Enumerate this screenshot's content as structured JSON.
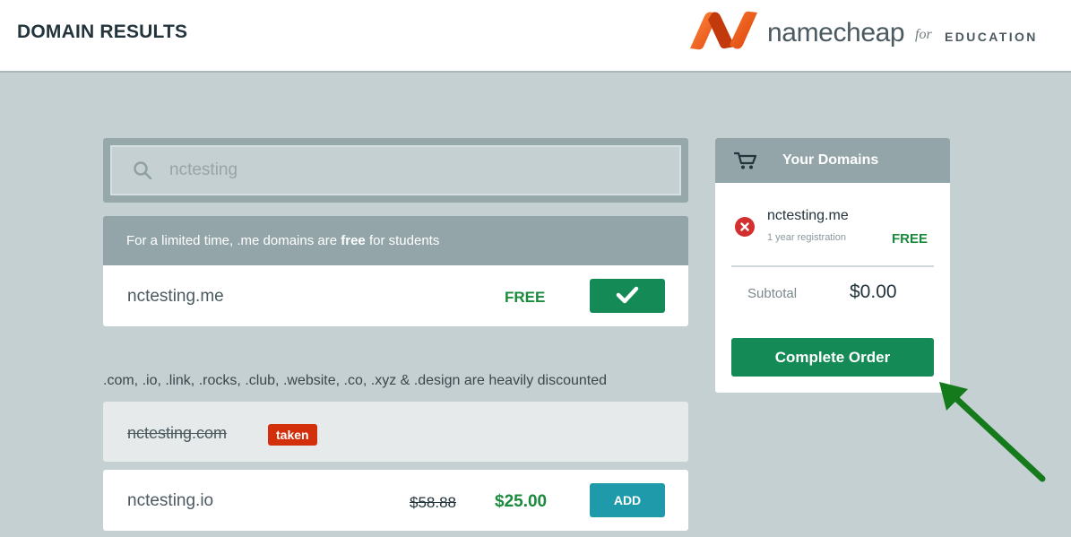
{
  "header": {
    "title": "DOMAIN RESULTS",
    "brand_name": "namecheap",
    "brand_for": "for",
    "brand_edu": "EDUCATION"
  },
  "search": {
    "value": "nctesting",
    "placeholder": "nctesting"
  },
  "promo": {
    "text_before": "For a limited time, .me domains are ",
    "text_bold": "free",
    "text_after": " for students"
  },
  "me_row": {
    "domain": "nctesting.me",
    "price": "FREE"
  },
  "discount_note": ".com, .io, .link, .rocks, .club, .website, .co, .xyz & .design are heavily discounted",
  "taken_row": {
    "domain": "nctesting.com",
    "badge": "taken"
  },
  "io_row": {
    "domain": "nctesting.io",
    "old_price": "$58.88",
    "new_price": "$25.00",
    "button_label": "ADD"
  },
  "cart": {
    "title": "Your Domains",
    "item_domain": "nctesting.me",
    "item_registration": "1 year registration",
    "item_price": "FREE",
    "subtotal_label": "Subtotal",
    "subtotal_value": "$0.00",
    "complete_button": "Complete Order"
  },
  "icons": {
    "search": "search-icon",
    "check": "checkmark-icon",
    "cart": "cart-icon",
    "remove": "remove-icon",
    "logo": "namecheap-logo-icon",
    "arrow": "green-arrow-icon"
  },
  "colors": {
    "accent_green": "#148a56",
    "price_green": "#1a8a3c",
    "add_blue": "#1f9aaa",
    "taken_red": "#d32f0b",
    "brand_orange": "#f26522"
  }
}
